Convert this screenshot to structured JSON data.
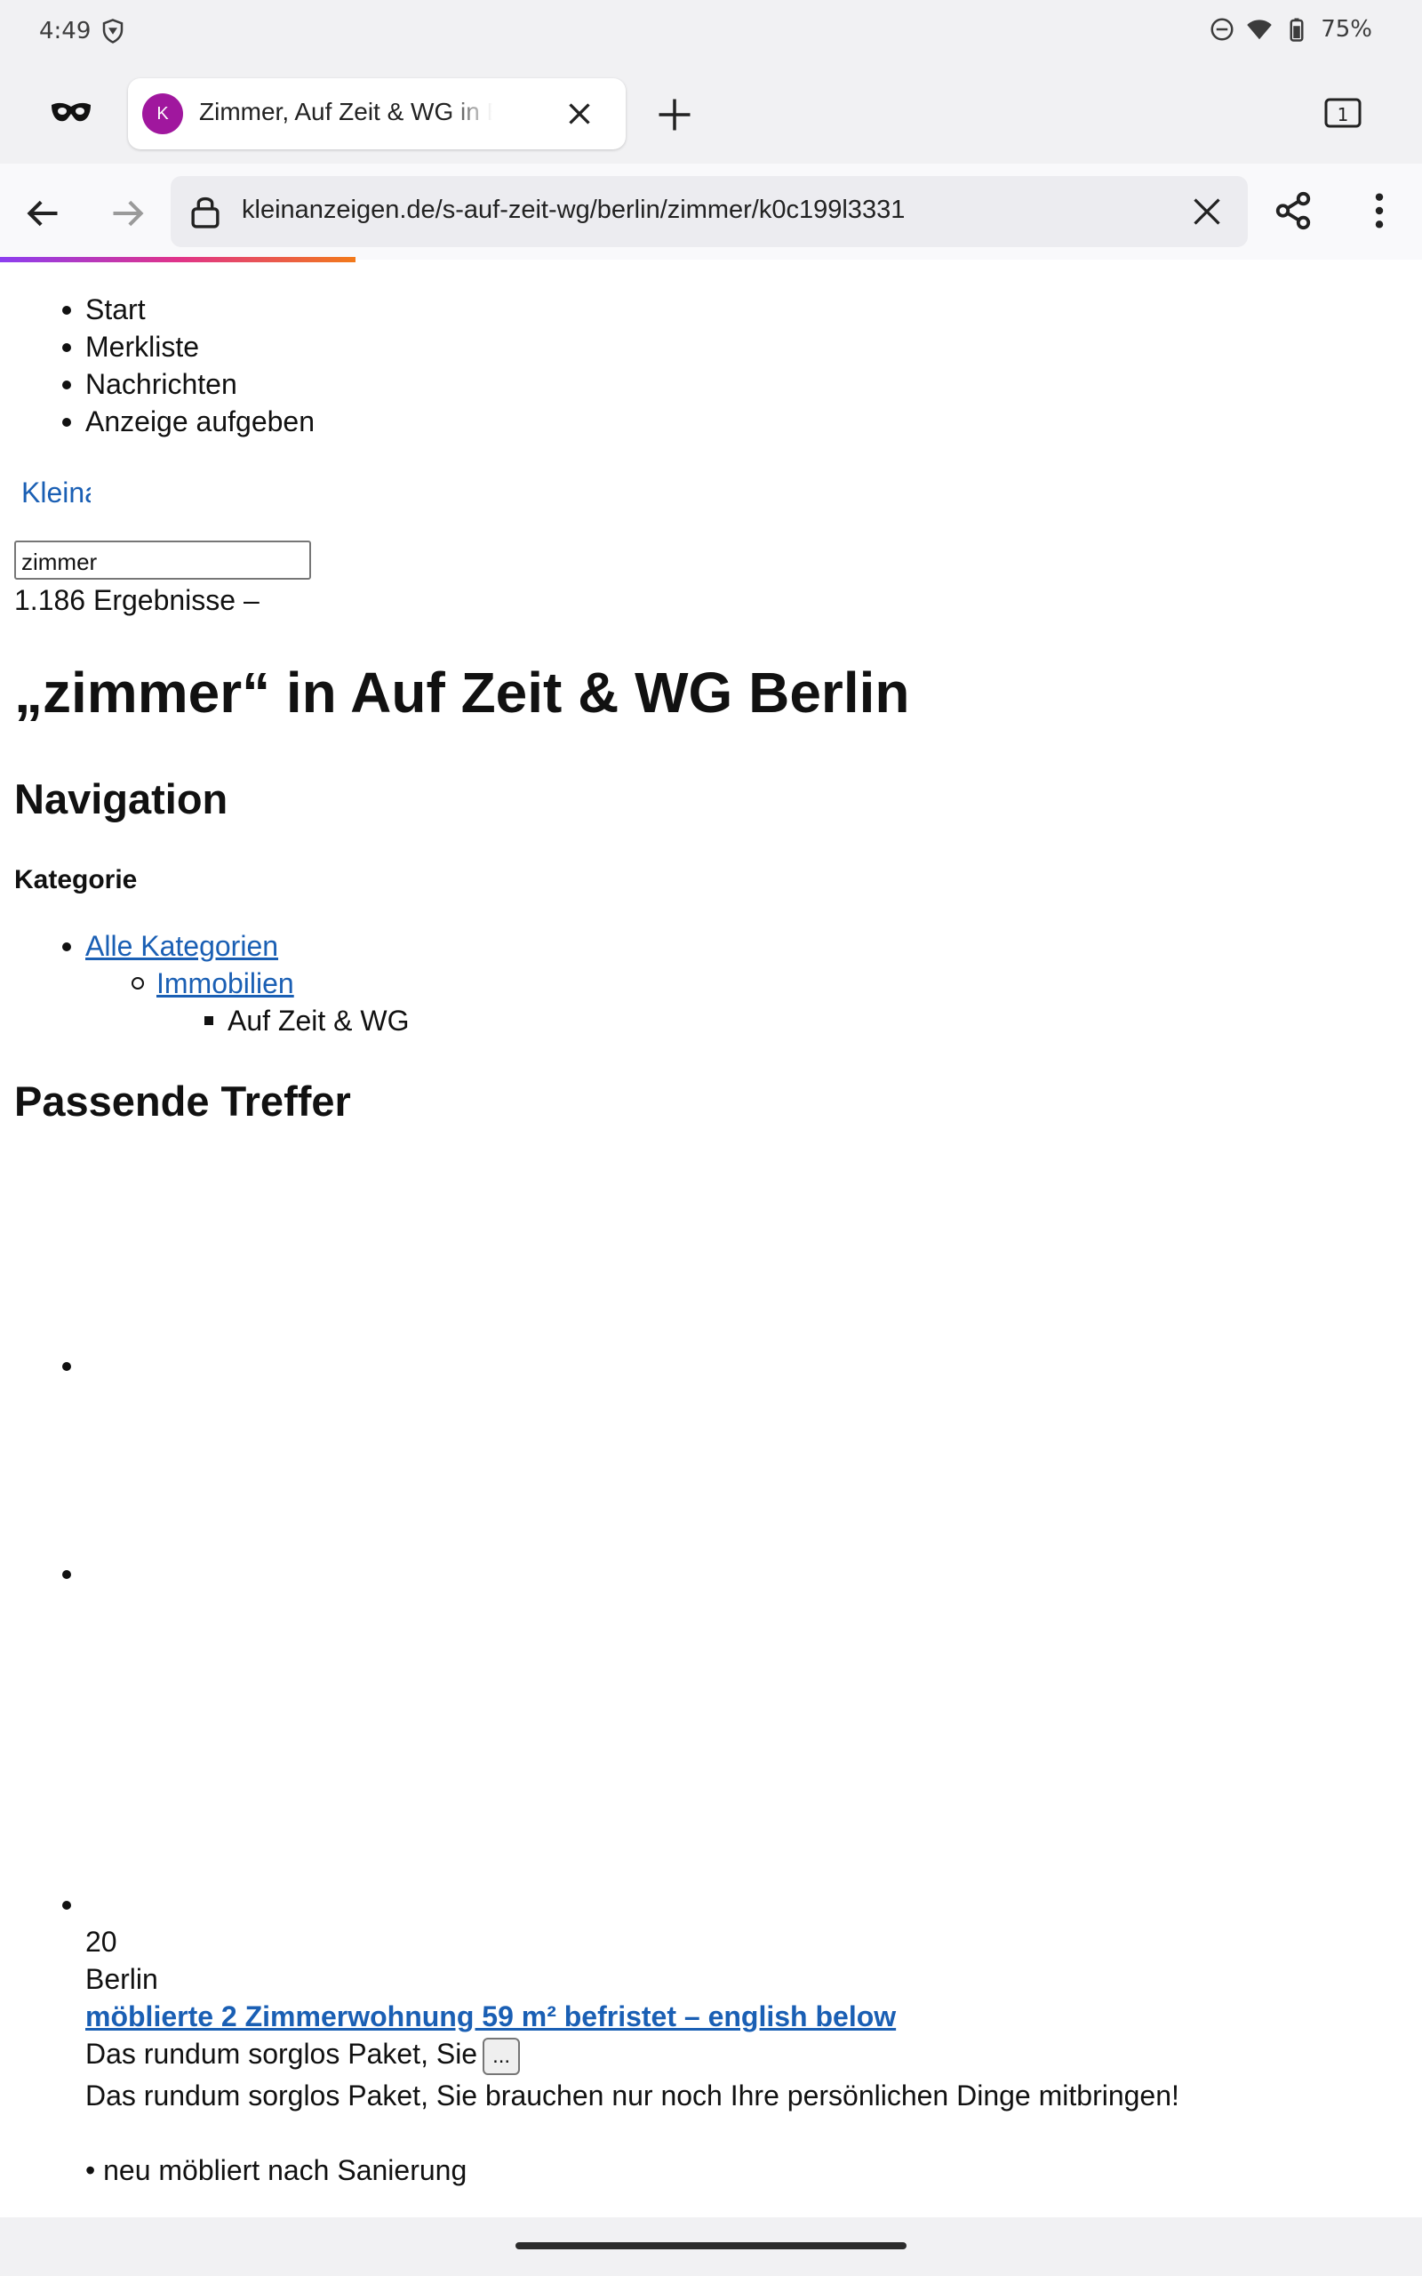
{
  "status_bar": {
    "time": "4:49",
    "battery": "75%"
  },
  "tab_bar": {
    "tab_favicon_letter": "K",
    "tab_title": "Zimmer, Auf Zeit & WG in Berlin",
    "tab_count": "1"
  },
  "address_bar": {
    "url": "kleinanzeigen.de/s-auf-zeit-wg/berlin/zimmer/k0c199l3331"
  },
  "page": {
    "top_nav": [
      "Start",
      "Merkliste",
      "Nachrichten",
      "Anzeige aufgeben"
    ],
    "logo_link": "Kleinanzeigen",
    "search_value": "zimmer",
    "result_count": "1.186 Ergebnisse –",
    "h1": "„zimmer“ in Auf Zeit & WG Berlin",
    "navigation_heading": "Navigation",
    "category_heading": "Kategorie",
    "categories": {
      "level1": "Alle Kategorien",
      "level2": "Immobilien",
      "level3": "Auf Zeit & WG"
    },
    "results_heading": "Passende Treffer",
    "listing": {
      "image_count": "20",
      "location": "Berlin",
      "title": "möblierte 2 Zimmerwohnung 59 m² befristet – english below",
      "teaser": "Das rundum sorglos Paket, Sie",
      "more_button": "...",
      "description": "Das rundum sorglos Paket, Sie brauchen nur noch Ihre persönlichen Dinge mitbringen!",
      "feature_1": "• neu möbliert nach Sanierung"
    }
  },
  "colors": {
    "link": "#1a5fb4",
    "favicon_bg": "#a0179e",
    "chrome_bg": "#f1f1f3"
  }
}
